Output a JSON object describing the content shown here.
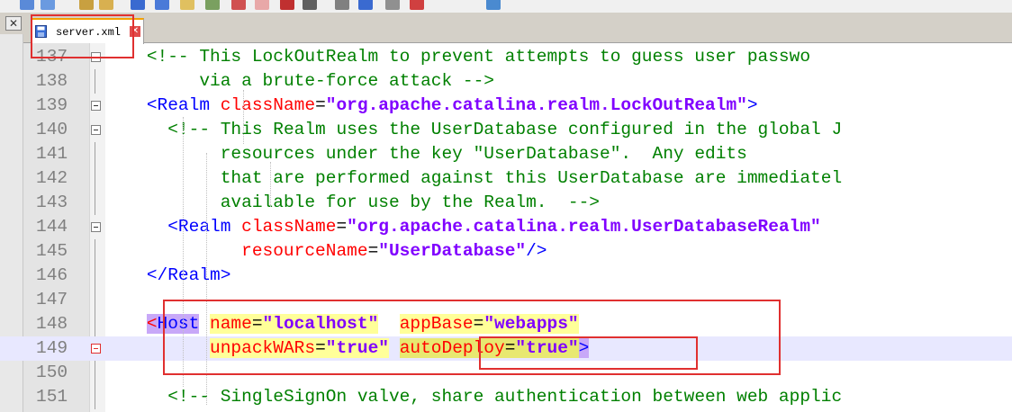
{
  "toolbar": {
    "icons": [
      "find-icon",
      "replace-icon",
      "cut-icon",
      "copy-icon",
      "wrap-icon",
      "indent-icon",
      "format-icon",
      "bookmark-icon",
      "image-icon",
      "macro-icon",
      "record-icon",
      "stop-icon",
      "play-icon",
      "save-macro-icon",
      "run-icon",
      "spell-icon",
      "monitor-icon"
    ]
  },
  "tabstrip": {
    "close_all_glyph": "✕",
    "tab_label": "server.xml",
    "tab_close_glyph": "✕"
  },
  "colors": {
    "comment": "#008000",
    "tag": "#0000ff",
    "attribute": "#ff0000",
    "value": "#8000ff",
    "annotation": "#e03030",
    "highlight_yellow": "#ffff99",
    "highlight_purple": "#c8a8f8"
  },
  "lines": [
    {
      "num": "137",
      "indent": "    ",
      "parts": [
        {
          "t": "<!-- This LockOutRealm to prevent attempts to guess user passwo",
          "c": "cm"
        }
      ]
    },
    {
      "num": "138",
      "indent": "         ",
      "parts": [
        {
          "t": "via a brute-force attack -->",
          "c": "cm"
        }
      ]
    },
    {
      "num": "139",
      "indent": "    ",
      "parts": [
        {
          "t": "<Realm ",
          "c": "tg"
        },
        {
          "t": "className",
          "c": "at"
        },
        {
          "t": "=",
          "c": "tx"
        },
        {
          "t": "\"org.apache.catalina.realm.LockOutRealm\"",
          "c": "vl"
        },
        {
          "t": ">",
          "c": "tg"
        }
      ]
    },
    {
      "num": "140",
      "indent": "      ",
      "parts": [
        {
          "t": "<!-- This Realm uses the UserDatabase configured in the global J",
          "c": "cm"
        }
      ]
    },
    {
      "num": "141",
      "indent": "           ",
      "parts": [
        {
          "t": "resources under the key \"UserDatabase\".  Any edits",
          "c": "cm"
        }
      ]
    },
    {
      "num": "142",
      "indent": "           ",
      "parts": [
        {
          "t": "that are performed against this UserDatabase are immediatel",
          "c": "cm"
        }
      ]
    },
    {
      "num": "143",
      "indent": "           ",
      "parts": [
        {
          "t": "available for use by the Realm.  -->",
          "c": "cm"
        }
      ]
    },
    {
      "num": "144",
      "indent": "      ",
      "parts": [
        {
          "t": "<Realm ",
          "c": "tg"
        },
        {
          "t": "className",
          "c": "at"
        },
        {
          "t": "=",
          "c": "tx"
        },
        {
          "t": "\"org.apache.catalina.realm.UserDatabaseRealm\"",
          "c": "vl"
        }
      ]
    },
    {
      "num": "145",
      "indent": "             ",
      "parts": [
        {
          "t": "resourceName",
          "c": "at"
        },
        {
          "t": "=",
          "c": "tx"
        },
        {
          "t": "\"UserDatabase\"",
          "c": "vl"
        },
        {
          "t": "/>",
          "c": "tg"
        }
      ]
    },
    {
      "num": "146",
      "indent": "    ",
      "parts": [
        {
          "t": "</Realm>",
          "c": "tg"
        }
      ]
    },
    {
      "num": "147",
      "indent": "",
      "parts": []
    },
    {
      "num": "148",
      "indent": "    ",
      "parts": [
        {
          "t": "<",
          "c": "at hl-p"
        },
        {
          "t": "Host",
          "c": "tg hl-p"
        },
        {
          "t": " ",
          "c": "tx"
        },
        {
          "t": "name",
          "c": "at hl-y"
        },
        {
          "t": "=",
          "c": "tx hl-y"
        },
        {
          "t": "\"localhost\"",
          "c": "vl hl-y"
        },
        {
          "t": "  ",
          "c": "tx"
        },
        {
          "t": "appBase",
          "c": "at hl-y"
        },
        {
          "t": "=",
          "c": "tx hl-y"
        },
        {
          "t": "\"webapps\"",
          "c": "vl hl-y"
        }
      ]
    },
    {
      "num": "149",
      "indent": "          ",
      "parts": [
        {
          "t": "unpackWARs",
          "c": "at hl-y"
        },
        {
          "t": "=",
          "c": "tx hl-y"
        },
        {
          "t": "\"true\"",
          "c": "vl hl-y"
        },
        {
          "t": " ",
          "c": "tx"
        },
        {
          "t": "autoDeploy",
          "c": "at hl-o"
        },
        {
          "t": "=",
          "c": "tx hl-o"
        },
        {
          "t": "\"true\"",
          "c": "vl hl-o"
        },
        {
          "t": ">",
          "c": "tg hl-p"
        }
      ]
    },
    {
      "num": "150",
      "indent": "",
      "parts": []
    },
    {
      "num": "151",
      "indent": "      ",
      "parts": [
        {
          "t": "<!-- SingleSignOn valve, share authentication between web applic",
          "c": "cm"
        }
      ]
    }
  ]
}
